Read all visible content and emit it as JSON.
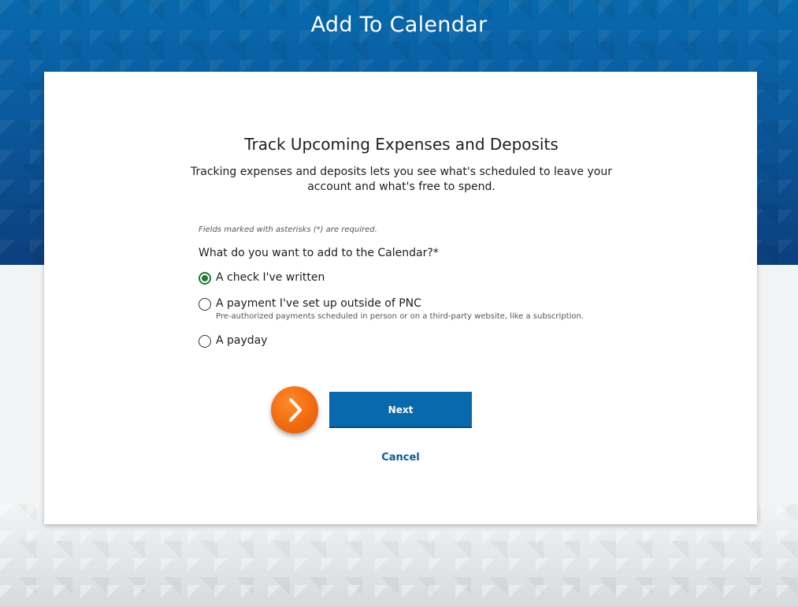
{
  "header": {
    "title": "Add To Calendar"
  },
  "card": {
    "heading": "Track Upcoming Expenses and Deposits",
    "description": "Tracking expenses and deposits lets you see what's scheduled to leave your account and what's free to spend.",
    "required_note": "Fields marked with asterisks (*) are required.",
    "question": "What do you want to add to the Calendar?*",
    "options": [
      {
        "label": "A check I've written",
        "hint": "",
        "selected": true
      },
      {
        "label": "A payment I've set up outside of PNC",
        "hint": "Pre-authorized payments scheduled in person or on a third-party website, like a subscription.",
        "selected": false
      },
      {
        "label": "A payday",
        "hint": "",
        "selected": false
      }
    ],
    "next_label": "Next",
    "cancel_label": "Cancel"
  },
  "colors": {
    "brand_blue": "#0869ad",
    "selected_green": "#1f7a3a",
    "tour_orange": "#f26a10"
  },
  "icons": {
    "tour_badge": "chevron-right-icon"
  }
}
